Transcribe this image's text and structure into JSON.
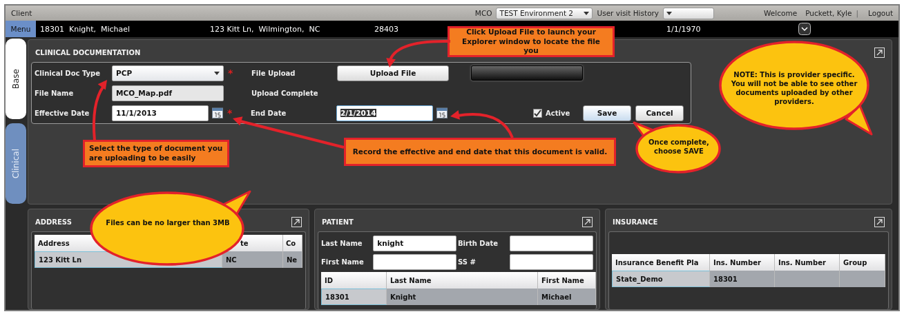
{
  "top_bar": {
    "title": "Client",
    "mco_label": "MCO",
    "mco_value": "TEST Environment 2",
    "history_label": "User visit History",
    "welcome": "Welcome",
    "user": "Puckett, Kyle",
    "separator": "|",
    "logout": "Logout"
  },
  "patient_bar": {
    "menu": "Menu",
    "name": "18301  Knight,  Michael",
    "address": "123 Kitt Ln,  Wilmington,  NC",
    "zip": "28403",
    "dob": "1/1/1970"
  },
  "side_tabs": [
    {
      "label": "Base",
      "selected": true
    },
    {
      "label": "Clinical",
      "selected": false
    }
  ],
  "clinical": {
    "title": "CLINICAL DOCUMENTATION",
    "left_fields": [
      {
        "label": "Clinical Doc Type",
        "kind": "select",
        "value": "PCP",
        "required_mark": "*"
      },
      {
        "label": "File Name",
        "kind": "readonly",
        "value": "MCO_Map.pdf"
      },
      {
        "label": "Effective Date",
        "kind": "date",
        "value": "11/1/2013",
        "required_mark": "*"
      }
    ],
    "file_upload_label": "File Upload",
    "upload_button": "Upload File",
    "upload_progress": {
      "level": 0
    },
    "upload_status": "Upload Complete",
    "end_date": {
      "label": "End Date",
      "kind": "date",
      "value": "2/1/2014",
      "focused": true
    },
    "active": {
      "label": "Active",
      "checked": true
    },
    "buttons": [
      {
        "label": "Save",
        "primary": true
      },
      {
        "label": "Cancel",
        "primary": false
      }
    ]
  },
  "address": {
    "title": "ADDRESS",
    "columns": [
      "Address",
      "te",
      "Co"
    ],
    "rows": [
      {
        "cells": [
          "123 Kitt Ln",
          "NC",
          "Ne"
        ],
        "selected": true
      }
    ]
  },
  "patient": {
    "title": "PATIENT",
    "fields": [
      {
        "label": "Last Name",
        "value": "knight"
      },
      {
        "label": "Birth Date"
      },
      {
        "label": "First Name"
      },
      {
        "label": "SS #"
      }
    ],
    "columns": [
      "ID",
      "Last Name",
      "First Name"
    ],
    "rows": [
      {
        "cells": [
          "18301",
          "Knight",
          "Michael"
        ],
        "selected": true
      }
    ]
  },
  "insurance": {
    "title": "INSURANCE",
    "columns": [
      "Insurance Benefit Pla",
      "Ins. Number",
      "Ins. Number",
      "Group"
    ],
    "rows": [
      {
        "cells": [
          "State_Demo",
          "18301",
          "",
          ""
        ],
        "selected": true
      }
    ]
  },
  "callouts": [
    {
      "kind": "box",
      "text": "Click Upload File to launch your Explorer window to locate the file you"
    },
    {
      "kind": "box",
      "text": "Select the type of document you are uploading to be easily"
    },
    {
      "kind": "box",
      "text": "Record the effective and end date that this document is valid."
    },
    {
      "kind": "bubble",
      "text": "Once complete, choose SAVE"
    },
    {
      "kind": "bubble",
      "text": "NOTE:  This is provider specific. You will not be able to see other documents uploaded by other providers."
    },
    {
      "kind": "bubble",
      "text": "Files can be no larger than 3MB"
    }
  ]
}
